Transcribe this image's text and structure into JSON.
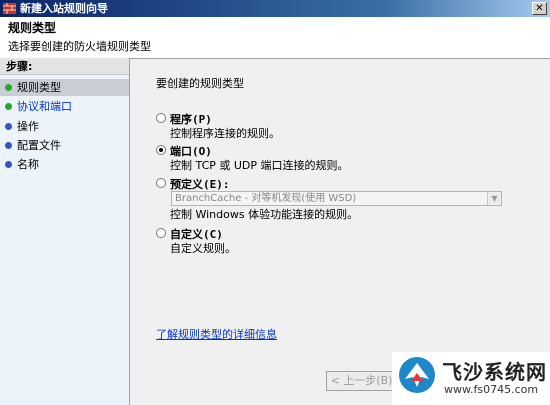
{
  "window": {
    "title": "新建入站规则向导",
    "close_glyph": "✕"
  },
  "header": {
    "title": "规则类型",
    "subtitle": "选择要创建的防火墙规则类型"
  },
  "steps": {
    "title": "步骤:",
    "items": [
      {
        "label": "规则类型",
        "dot_color": "#22aa22"
      },
      {
        "label": "协议和端口",
        "dot_color": "#22aa22"
      },
      {
        "label": "操作",
        "dot_color": "#3355cc"
      },
      {
        "label": "配置文件",
        "dot_color": "#3355cc"
      },
      {
        "label": "名称",
        "dot_color": "#3355cc"
      }
    ]
  },
  "main": {
    "lead": "要创建的规则类型",
    "options": [
      {
        "label": "程序(P)",
        "desc": "控制程序连接的规则。",
        "checked": false
      },
      {
        "label": "端口(O)",
        "desc": "控制 TCP 或 UDP 端口连接的规则。",
        "checked": true
      },
      {
        "label": "预定义(E):",
        "desc": "控制 Windows 体验功能连接的规则。",
        "checked": false
      },
      {
        "label": "自定义(C)",
        "desc": "自定义规则。",
        "checked": false
      }
    ],
    "predefined_select": "BranchCache - 对等机发现(使用 WSD)",
    "more_link": "了解规则类型的详细信息"
  },
  "buttons": {
    "back": "< 上一步(B)"
  },
  "watermark": {
    "name": "飞沙系统网",
    "url": "www.fs0745.com"
  }
}
